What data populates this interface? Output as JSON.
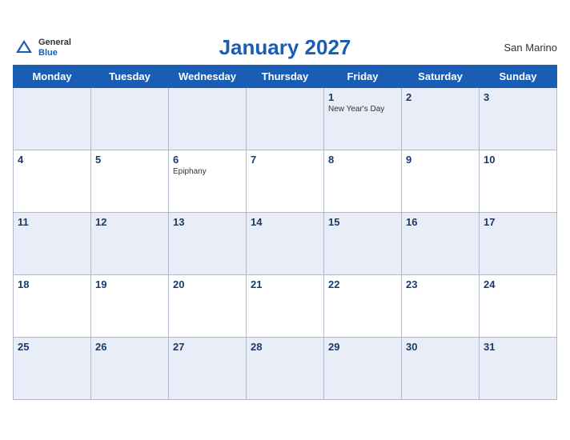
{
  "header": {
    "title": "January 2027",
    "country": "San Marino",
    "logo": {
      "general": "General",
      "blue": "Blue"
    }
  },
  "days_of_week": [
    "Monday",
    "Tuesday",
    "Wednesday",
    "Thursday",
    "Friday",
    "Saturday",
    "Sunday"
  ],
  "weeks": [
    [
      {
        "day": "",
        "holiday": ""
      },
      {
        "day": "",
        "holiday": ""
      },
      {
        "day": "",
        "holiday": ""
      },
      {
        "day": "",
        "holiday": ""
      },
      {
        "day": "1",
        "holiday": "New Year's Day"
      },
      {
        "day": "2",
        "holiday": ""
      },
      {
        "day": "3",
        "holiday": ""
      }
    ],
    [
      {
        "day": "4",
        "holiday": ""
      },
      {
        "day": "5",
        "holiday": ""
      },
      {
        "day": "6",
        "holiday": "Epiphany"
      },
      {
        "day": "7",
        "holiday": ""
      },
      {
        "day": "8",
        "holiday": ""
      },
      {
        "day": "9",
        "holiday": ""
      },
      {
        "day": "10",
        "holiday": ""
      }
    ],
    [
      {
        "day": "11",
        "holiday": ""
      },
      {
        "day": "12",
        "holiday": ""
      },
      {
        "day": "13",
        "holiday": ""
      },
      {
        "day": "14",
        "holiday": ""
      },
      {
        "day": "15",
        "holiday": ""
      },
      {
        "day": "16",
        "holiday": ""
      },
      {
        "day": "17",
        "holiday": ""
      }
    ],
    [
      {
        "day": "18",
        "holiday": ""
      },
      {
        "day": "19",
        "holiday": ""
      },
      {
        "day": "20",
        "holiday": ""
      },
      {
        "day": "21",
        "holiday": ""
      },
      {
        "day": "22",
        "holiday": ""
      },
      {
        "day": "23",
        "holiday": ""
      },
      {
        "day": "24",
        "holiday": ""
      }
    ],
    [
      {
        "day": "25",
        "holiday": ""
      },
      {
        "day": "26",
        "holiday": ""
      },
      {
        "day": "27",
        "holiday": ""
      },
      {
        "day": "28",
        "holiday": ""
      },
      {
        "day": "29",
        "holiday": ""
      },
      {
        "day": "30",
        "holiday": ""
      },
      {
        "day": "31",
        "holiday": ""
      }
    ]
  ]
}
